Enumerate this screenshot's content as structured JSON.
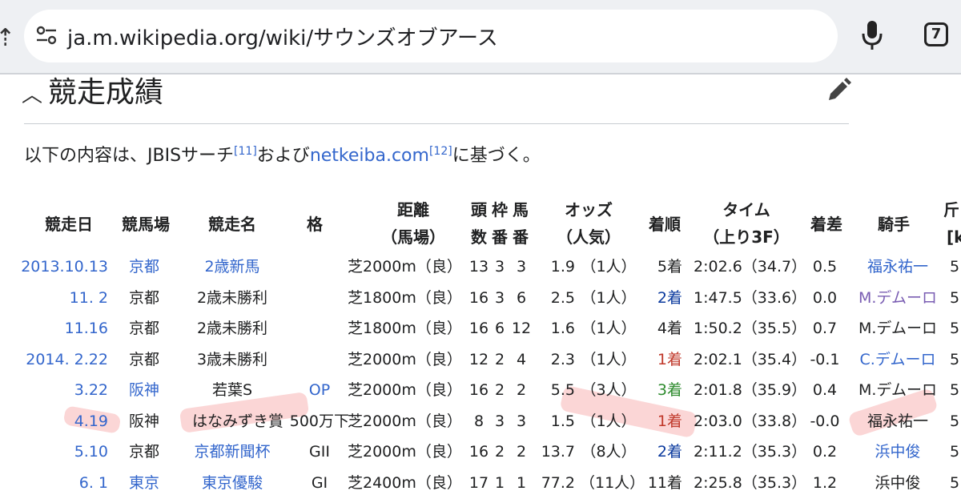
{
  "browser": {
    "url": "ja.m.wikipedia.org/wiki/サウンズオブアース",
    "tab_count": "7"
  },
  "section": {
    "heading": "競走成績",
    "intro_prefix": "以下の内容は、JBISサーチ",
    "intro_ref1": "[11]",
    "intro_mid": "および",
    "intro_link": "netkeiba.com",
    "intro_ref2": "[12]",
    "intro_suffix": "に基づく。"
  },
  "table": {
    "headers": {
      "date": "競走日",
      "track": "競馬場",
      "race": "競走名",
      "grade": "格",
      "distance_1": "距離",
      "distance_2": "（馬場）",
      "field_1": "頭",
      "field_2": "数",
      "frame_1": "枠",
      "frame_2": "番",
      "horse_1": "馬",
      "horse_2": "番",
      "odds_1": "オッズ",
      "odds_2": "（人気）",
      "finish": "着順",
      "time_1": "タイム",
      "time_2": "（上り3F）",
      "margin": "着差",
      "jockey": "騎手",
      "weight_1": "斤",
      "weight_2": "[k"
    },
    "rows": [
      {
        "date": "2013.10.13",
        "track": "京都",
        "race": "2歳新馬",
        "grade": "",
        "distance": "芝2000m（良）",
        "field": "13",
        "frame": "3",
        "horse": "3",
        "odds": "1.9",
        "pop": "（1人）",
        "finish": "5着",
        "time": "2:02.6（34.7）",
        "margin": "0.5",
        "jockey": "福永祐一",
        "weight": "5"
      },
      {
        "date": "11. 2",
        "track": "京都",
        "race": "2歳未勝利",
        "grade": "",
        "distance": "芝1800m（良）",
        "field": "16",
        "frame": "3",
        "horse": "6",
        "odds": "2.5",
        "pop": "（1人）",
        "finish": "2着",
        "time": "1:47.5（33.6）",
        "margin": "0.0",
        "jockey": "M.デムーロ",
        "weight": "5"
      },
      {
        "date": "11.16",
        "track": "京都",
        "race": "2歳未勝利",
        "grade": "",
        "distance": "芝1800m（良）",
        "field": "16",
        "frame": "6",
        "horse": "12",
        "odds": "1.6",
        "pop": "（1人）",
        "finish": "4着",
        "time": "1:50.2（35.5）",
        "margin": "0.7",
        "jockey": "M.デムーロ",
        "weight": "5"
      },
      {
        "date": "2014. 2.22",
        "track": "京都",
        "race": "3歳未勝利",
        "grade": "",
        "distance": "芝2000m（良）",
        "field": "12",
        "frame": "2",
        "horse": "4",
        "odds": "2.3",
        "pop": "（1人）",
        "finish": "1着",
        "time": "2:02.1（35.4）",
        "margin": "-0.1",
        "jockey": "C.デムーロ",
        "weight": "5"
      },
      {
        "date": "3.22",
        "track": "阪神",
        "race": "若葉S",
        "grade": "OP",
        "distance": "芝2000m（良）",
        "field": "16",
        "frame": "2",
        "horse": "2",
        "odds": "5.5",
        "pop": "（3人）",
        "finish": "3着",
        "time": "2:01.8（35.9）",
        "margin": "0.4",
        "jockey": "M.デムーロ",
        "weight": "5"
      },
      {
        "date": "4.19",
        "track": "阪神",
        "race": "はなみずき賞",
        "grade": "500万下",
        "distance": "芝2000m（良）",
        "field": "8",
        "frame": "3",
        "horse": "3",
        "odds": "1.5",
        "pop": "（1人）",
        "finish": "1着",
        "time": "2:03.0（33.8）",
        "margin": "-0.0",
        "jockey": "福永祐一",
        "weight": "5"
      },
      {
        "date": "5.10",
        "track": "京都",
        "race": "京都新聞杯",
        "grade": "GII",
        "distance": "芝2000m（良）",
        "field": "16",
        "frame": "2",
        "horse": "2",
        "odds": "13.7",
        "pop": "（8人）",
        "finish": "2着",
        "time": "2:11.2（35.3）",
        "margin": "0.2",
        "jockey": "浜中俊",
        "weight": "5"
      },
      {
        "date": "6. 1",
        "track": "東京",
        "race": "東京優駿",
        "grade": "GI",
        "distance": "芝2400m（良）",
        "field": "17",
        "frame": "1",
        "horse": "1",
        "odds": "77.2",
        "pop": "（11人）",
        "finish": "11着",
        "time": "2:25.8（35.3）",
        "margin": "1.2",
        "jockey": "浜中俊",
        "weight": "5"
      }
    ]
  }
}
